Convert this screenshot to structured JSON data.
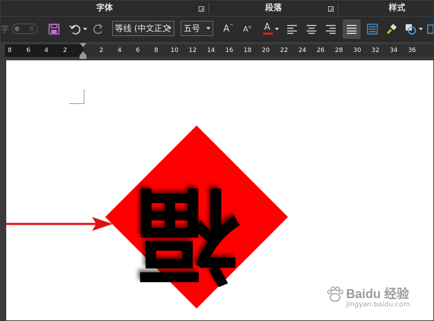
{
  "ribbon": {
    "groups": [
      {
        "label": "字体"
      },
      {
        "label": "段落"
      },
      {
        "label": "样式"
      }
    ],
    "toolbar": {
      "ghost_char": "字",
      "toggle_label": "关",
      "font_name": "等线 (中文正文",
      "font_size": "五号",
      "font_color": "#e02020"
    }
  },
  "ruler": {
    "ticks": [
      "8",
      "6",
      "4",
      "2",
      "2",
      "4",
      "6",
      "8",
      "10",
      "12",
      "14",
      "16",
      "18",
      "20",
      "22",
      "24",
      "26",
      "28",
      "30",
      "32",
      "34",
      "36"
    ]
  },
  "document": {
    "fu_character": "福",
    "diamond_color": "#ff0000",
    "arrow_color": "#e01010"
  },
  "watermark": {
    "brand": "Baidu 经验",
    "url": "jingyan.baidu.com"
  }
}
